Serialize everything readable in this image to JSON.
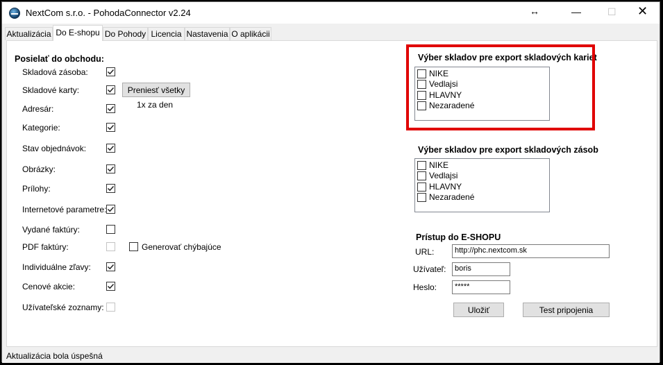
{
  "window": {
    "title": "NextCom s.r.o. - PohodaConnector v2.24"
  },
  "tabs": [
    {
      "label": "Aktualizácia"
    },
    {
      "label": "Do E-shopu"
    },
    {
      "label": "Do Pohody"
    },
    {
      "label": "Licencia"
    },
    {
      "label": "Nastavenia"
    },
    {
      "label": "O aplikácii"
    }
  ],
  "active_tab": "Do E-shopu",
  "send": {
    "title": "Posielať do obchodu:",
    "items": [
      {
        "label": "Skladová zásoba:",
        "checked": true,
        "enabled": true
      },
      {
        "label": "Skladové karty:",
        "checked": true,
        "enabled": true
      },
      {
        "label": "Adresár:",
        "checked": true,
        "enabled": true
      },
      {
        "label": "Kategorie:",
        "checked": true,
        "enabled": true
      },
      {
        "label": "Stav objednávok:",
        "checked": true,
        "enabled": true
      },
      {
        "label": "Obrázky:",
        "checked": true,
        "enabled": true
      },
      {
        "label": "Prílohy:",
        "checked": true,
        "enabled": true
      },
      {
        "label": "Internetové parametre:",
        "checked": true,
        "enabled": true
      },
      {
        "label": "Vydané faktúry:",
        "checked": false,
        "enabled": true
      },
      {
        "label": "PDF faktúry:",
        "checked": false,
        "enabled": false
      },
      {
        "label": "Individuálne zľavy:",
        "checked": true,
        "enabled": true
      },
      {
        "label": "Cenové akcie:",
        "checked": true,
        "enabled": true
      },
      {
        "label": "Užívateľské zoznamy:",
        "checked": false,
        "enabled": false
      }
    ],
    "transfer_all_label": "Preniesť všetky",
    "frequency_label": "1x za den",
    "generate_missing_label": "Generovať chýbajúce",
    "generate_missing_checked": false
  },
  "stock_cards": {
    "title": "Výber skladov pre export skladových kariet",
    "items": [
      {
        "label": "NIKE",
        "checked": false
      },
      {
        "label": "Vedlajsi",
        "checked": false
      },
      {
        "label": "HLAVNY",
        "checked": false
      },
      {
        "label": "Nezaradené",
        "checked": false
      }
    ]
  },
  "stock_levels": {
    "title": "Výber skladov pre export skladových zásob",
    "items": [
      {
        "label": "NIKE",
        "checked": false
      },
      {
        "label": "Vedlajsi",
        "checked": false
      },
      {
        "label": "HLAVNY",
        "checked": false
      },
      {
        "label": "Nezaradené",
        "checked": false
      }
    ]
  },
  "eshop_access": {
    "title": "Prístup do E-SHOPU",
    "url_label": "URL:",
    "url_value": "http://phc.nextcom.sk",
    "user_label": "Užívateľ:",
    "user_value": "boris",
    "password_label": "Heslo:",
    "password_value": "*****",
    "save_label": "Uložiť",
    "test_label": "Test pripojenia"
  },
  "status": {
    "text": "Aktualizácia bola úspešná"
  },
  "colors": {
    "highlight": "#e00000",
    "panel_bg": "#ffffff",
    "window_bg": "#f0f0f0"
  }
}
